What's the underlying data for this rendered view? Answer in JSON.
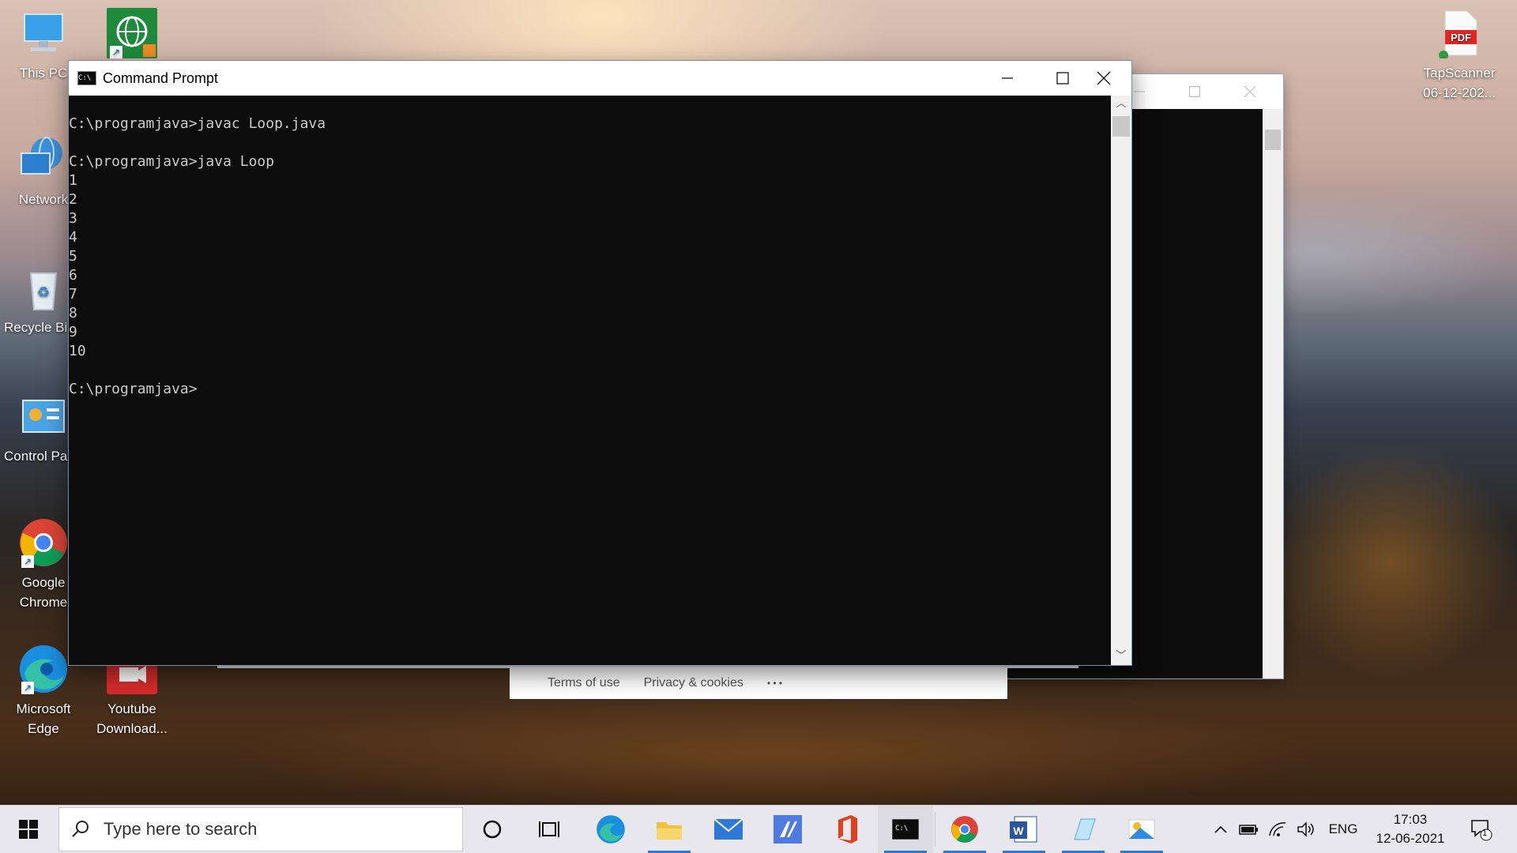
{
  "desktop": {
    "icons": [
      {
        "label": "This PC"
      },
      {
        "label": "Network"
      },
      {
        "label": "Recycle Bin"
      },
      {
        "label": "Control Panel"
      },
      {
        "label": "Google Chrome"
      },
      {
        "label": "Microsoft Edge"
      },
      {
        "label": "Youtube Download..."
      },
      {
        "label": "TapScanner 06-12-202..."
      }
    ]
  },
  "cmd_window": {
    "title": "Command Prompt",
    "lines": [
      "C:\\programjava>javac Loop.java",
      "",
      "C:\\programjava>java Loop",
      "1",
      "2",
      "3",
      "4",
      "5",
      "6",
      "7",
      "8",
      "9",
      "10",
      "",
      "C:\\programjava>"
    ]
  },
  "footer_strip": {
    "terms": "Terms of use",
    "privacy": "Privacy & cookies",
    "more": "• • •"
  },
  "taskbar": {
    "search_placeholder": "Type here to search",
    "language": "ENG",
    "time": "17:03",
    "date": "12-06-2021",
    "notification_count": "1"
  },
  "colors": {
    "terminal_bg": "#0c0c0c",
    "terminal_text": "#cccccc",
    "taskbar_bg": "#e8e7ee",
    "accent": "#2f79d6"
  }
}
